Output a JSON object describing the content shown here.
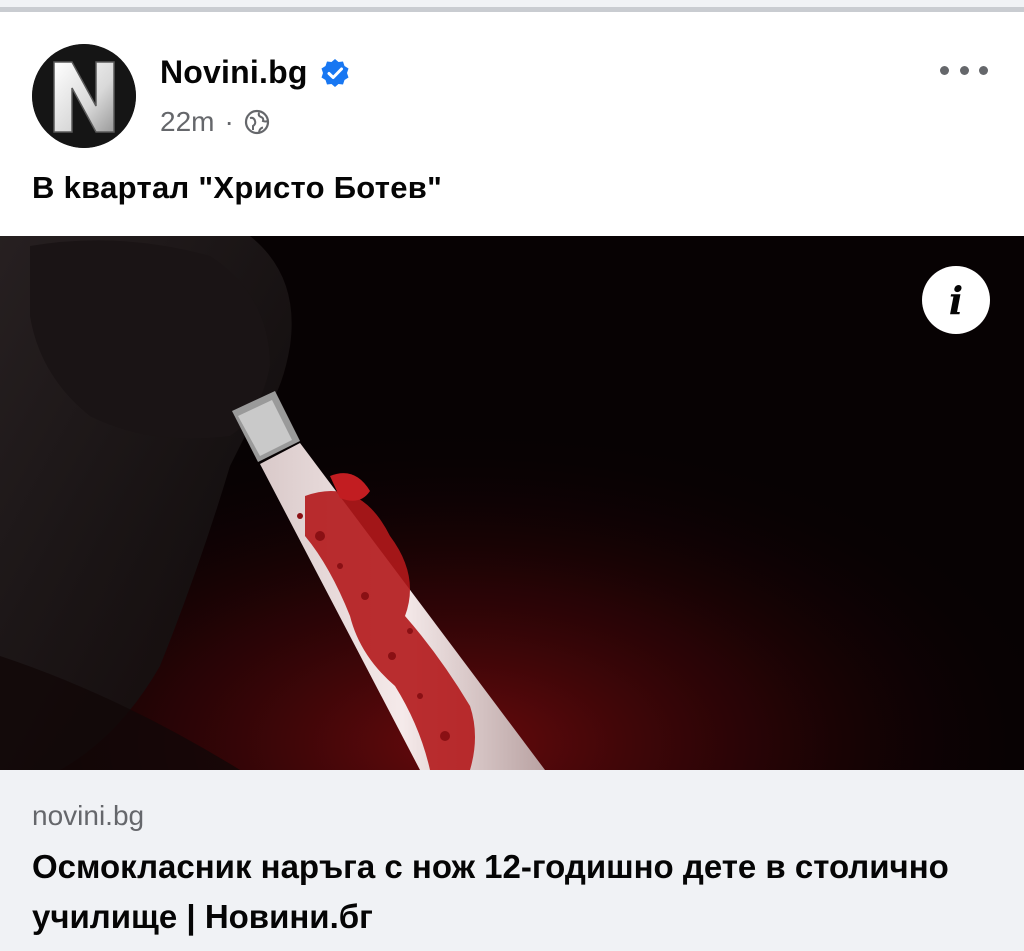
{
  "post": {
    "page_name": "Novini.bg",
    "avatar_letter": "N",
    "verified": true,
    "timestamp": "22m",
    "separator": "·",
    "caption": "В kвартал \"Христо Ботев\""
  },
  "media": {
    "info_label": "i",
    "icon_names": [
      "knife-image",
      "info-icon"
    ]
  },
  "link_preview": {
    "domain": "novini.bg",
    "title": "Осмокласник наръга с нож 12-годишно дете в столично училище | Новини.бг"
  },
  "icons": {
    "verified": "verified-badge-icon",
    "audience": "globe-icon",
    "more": "more-options-icon"
  },
  "colors": {
    "verified_blue": "#1877f2",
    "secondary_text": "#65676b",
    "preview_bg": "#f0f2f5",
    "blood_red": "#9b0f12"
  }
}
